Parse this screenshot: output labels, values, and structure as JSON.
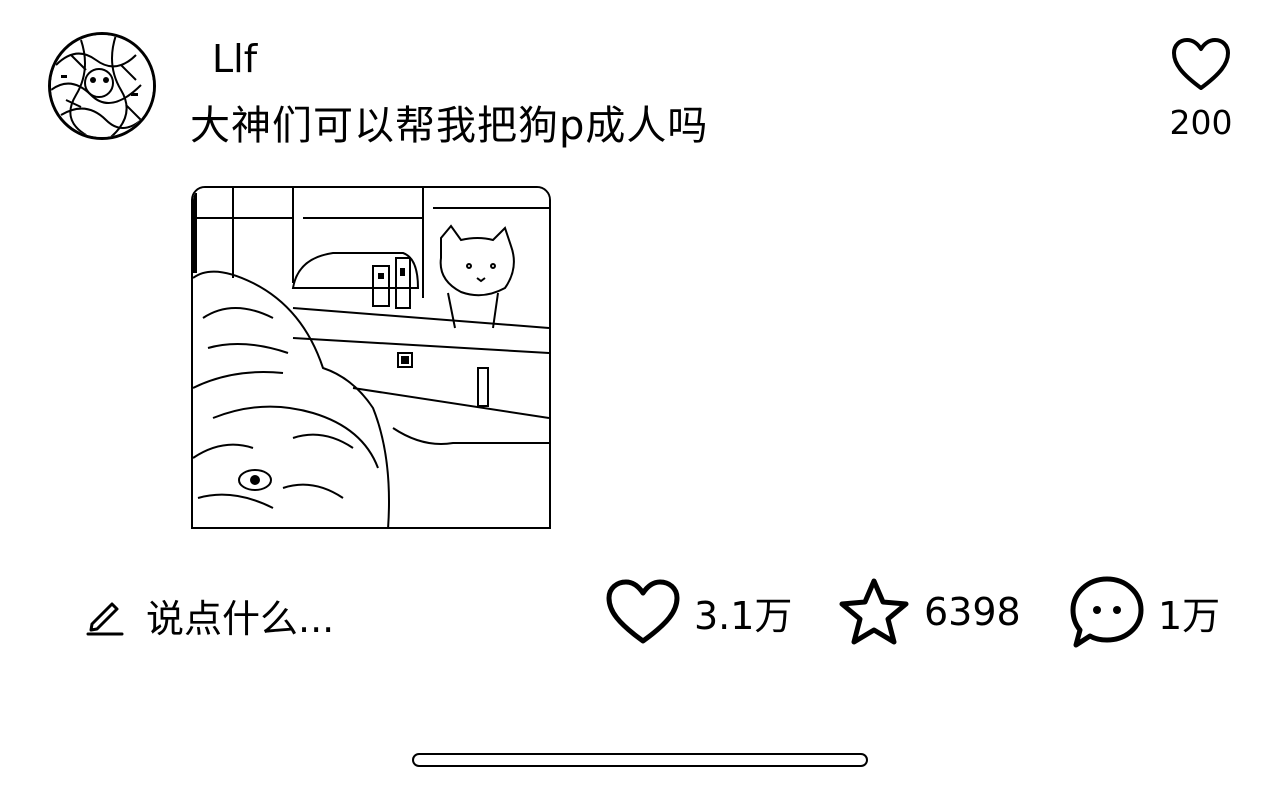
{
  "post": {
    "author": {
      "name": "Llf",
      "avatar_icon": "avatar-image"
    },
    "text": "大神们可以帮我把狗p成人吗",
    "like_top_icon": "heart-icon",
    "like_top_count": "200",
    "image_icon": "photo-dog-and-cat"
  },
  "footer": {
    "comment_placeholder": "说点什么...",
    "pen_icon": "pencil-icon",
    "likes": {
      "icon": "heart-icon",
      "count": "3.1万"
    },
    "favorites": {
      "icon": "star-icon",
      "count": "6398"
    },
    "comments": {
      "icon": "comment-bubble-icon",
      "count": "1万"
    }
  },
  "colors": {
    "text": "#000000",
    "background": "#ffffff"
  }
}
